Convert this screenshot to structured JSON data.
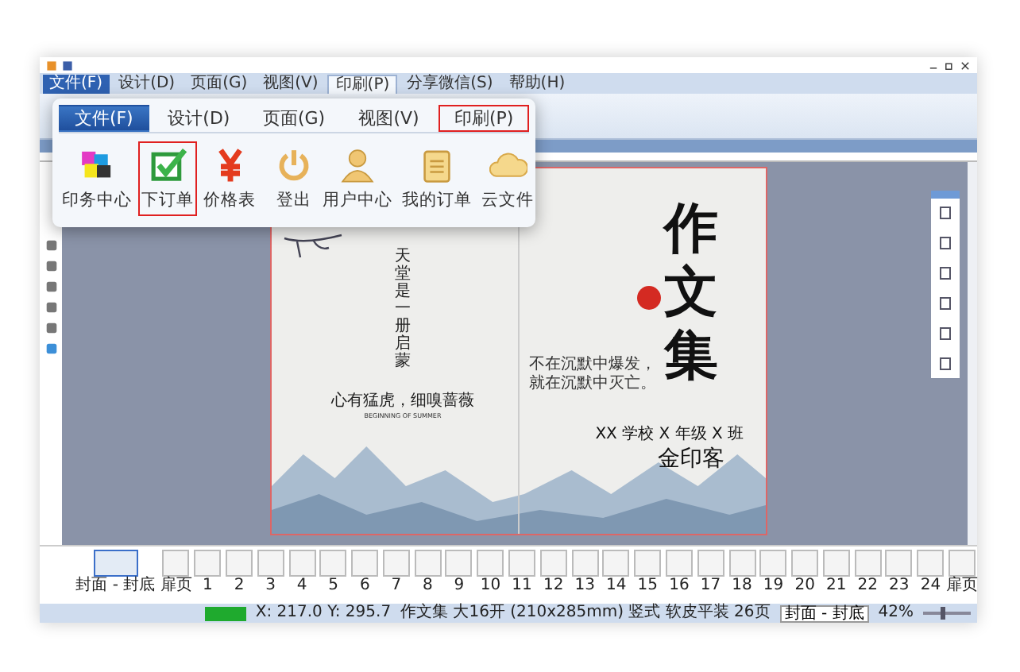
{
  "menu_bar": {
    "tabs": [
      {
        "label": "文件(F)",
        "kind": "file",
        "selected": false
      },
      {
        "label": "设计(D)",
        "kind": "tab",
        "selected": false
      },
      {
        "label": "页面(G)",
        "kind": "tab",
        "selected": false
      },
      {
        "label": "视图(V)",
        "kind": "tab",
        "selected": false
      },
      {
        "label": "印刷(P)",
        "kind": "tab",
        "selected": true
      },
      {
        "label": "分享微信(S)",
        "kind": "tab",
        "selected": false
      },
      {
        "label": "帮助(H)",
        "kind": "tab",
        "selected": false
      }
    ]
  },
  "ribbon_popup": {
    "tabs": [
      {
        "label": "文件(F)",
        "selected": true,
        "highlighted": false
      },
      {
        "label": "设计(D)",
        "selected": false,
        "highlighted": false
      },
      {
        "label": "页面(G)",
        "selected": false,
        "highlighted": false
      },
      {
        "label": "视图(V)",
        "selected": false,
        "highlighted": false
      },
      {
        "label": "印刷(P)",
        "selected": false,
        "highlighted": true
      }
    ],
    "groups": [
      {
        "items": [
          {
            "label": "印务中心",
            "kind": "puzzle",
            "highlighted": false
          },
          {
            "label": "下订单",
            "kind": "check",
            "highlighted": true
          },
          {
            "label": "价格表",
            "kind": "yen",
            "highlighted": false
          }
        ]
      },
      {
        "items": [
          {
            "label": "登出",
            "kind": "power",
            "highlighted": false
          },
          {
            "label": "用户中心",
            "kind": "user",
            "highlighted": false
          },
          {
            "label": "我的订单",
            "kind": "clipboard",
            "highlighted": false
          },
          {
            "label": "云文件",
            "kind": "cloud",
            "highlighted": false
          }
        ]
      }
    ]
  },
  "page": {
    "left": {
      "vertical_text": "天堂是一册启蒙",
      "motto": "心有猛虎，细嗅蔷薇",
      "motto_subtitle": "BEGINNING OF SUMMER"
    },
    "right": {
      "title_chars": [
        "作",
        "文",
        "集"
      ],
      "quote_lines": [
        "不在沉默中爆发，",
        "就在沉默中灭亡。"
      ],
      "class_line": "XX 学校 X 年级 X 班",
      "author": "金印客"
    }
  },
  "thumbnails": [
    {
      "label": "封面 - 封底",
      "selected": true
    },
    {
      "label": "扉页",
      "selected": false
    },
    {
      "label": "1",
      "selected": false
    },
    {
      "label": "2",
      "selected": false
    },
    {
      "label": "3",
      "selected": false
    },
    {
      "label": "4",
      "selected": false
    },
    {
      "label": "5",
      "selected": false
    },
    {
      "label": "6",
      "selected": false
    },
    {
      "label": "7",
      "selected": false
    },
    {
      "label": "8",
      "selected": false
    },
    {
      "label": "9",
      "selected": false
    },
    {
      "label": "10",
      "selected": false
    },
    {
      "label": "11",
      "selected": false
    },
    {
      "label": "12",
      "selected": false
    },
    {
      "label": "13",
      "selected": false
    },
    {
      "label": "14",
      "selected": false
    },
    {
      "label": "15",
      "selected": false
    },
    {
      "label": "16",
      "selected": false
    },
    {
      "label": "17",
      "selected": false
    },
    {
      "label": "18",
      "selected": false
    },
    {
      "label": "19",
      "selected": false
    },
    {
      "label": "20",
      "selected": false
    },
    {
      "label": "21",
      "selected": false
    },
    {
      "label": "22",
      "selected": false
    },
    {
      "label": "23",
      "selected": false
    },
    {
      "label": "24",
      "selected": false
    },
    {
      "label": "扉页",
      "selected": false
    }
  ],
  "status_bar": {
    "progress": {
      "level": 1
    },
    "zoom_slider": {
      "level": 0.42
    },
    "coordinates": "X: 217.0  Y: 295.7",
    "document_info": "作文集 大16开 (210x285mm) 竖式 软皮平装 26页",
    "page_select": "封面 - 封底",
    "zoom": "42%"
  }
}
